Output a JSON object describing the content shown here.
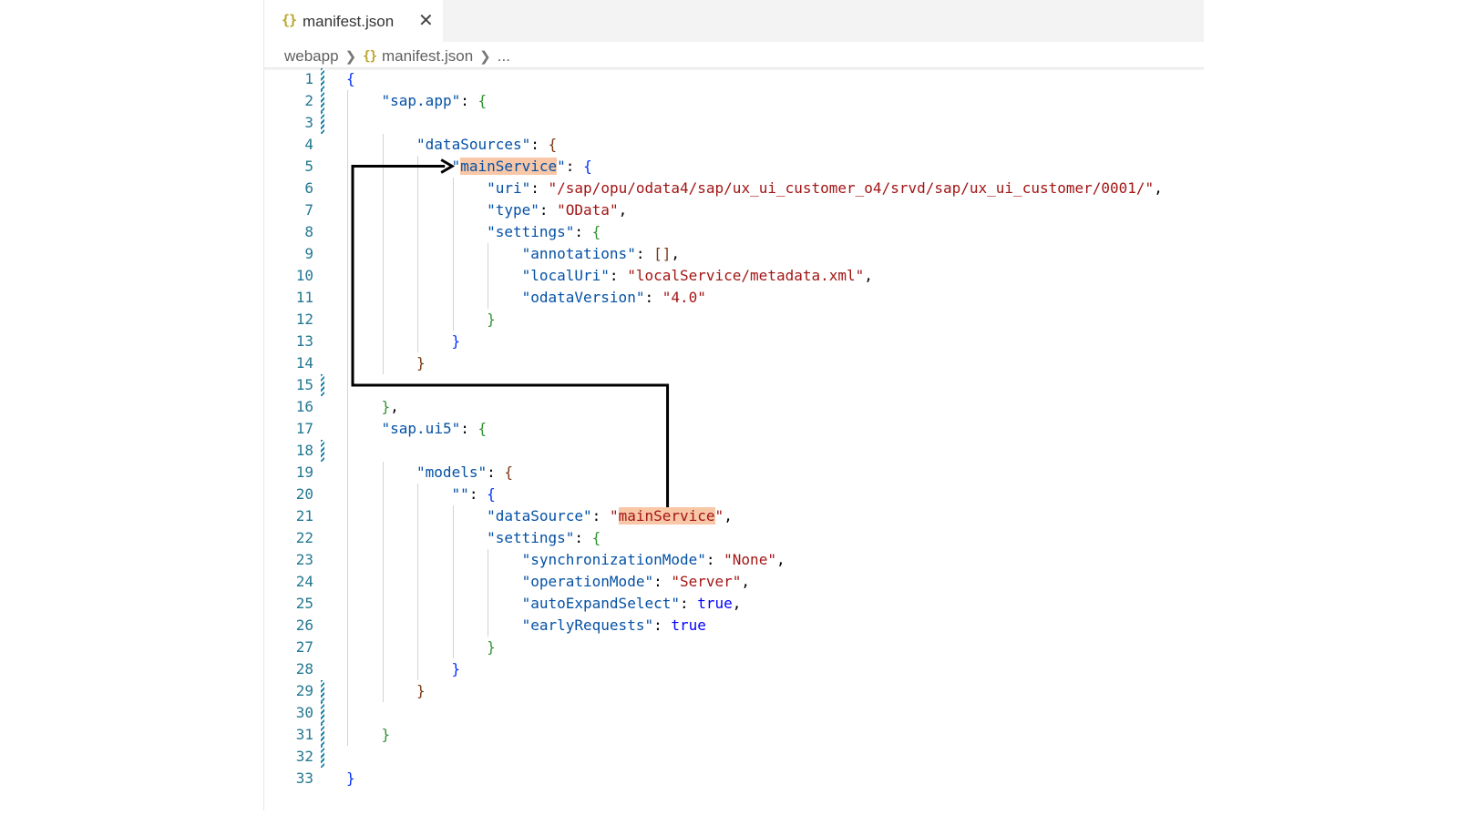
{
  "tab": {
    "icon": "{}",
    "label": "manifest.json",
    "close": "✕"
  },
  "breadcrumb": {
    "folder": "webapp",
    "icon": "{}",
    "file": "manifest.json",
    "more": "..."
  },
  "code_lines": [
    {
      "n": "1",
      "indent": 0,
      "tokens": [
        {
          "t": "{",
          "c": "p1"
        }
      ]
    },
    {
      "n": "2",
      "indent": 1,
      "tokens": [
        {
          "t": "\"sap.app\"",
          "c": "k"
        },
        {
          "t": ": "
        },
        {
          "t": "{",
          "c": "p2"
        }
      ]
    },
    {
      "n": "3",
      "indent": 0,
      "tokens": []
    },
    {
      "n": "4",
      "indent": 2,
      "tokens": [
        {
          "t": "\"dataSources\"",
          "c": "k"
        },
        {
          "t": ": "
        },
        {
          "t": "{",
          "c": "p3"
        }
      ]
    },
    {
      "n": "5",
      "indent": 3,
      "tokens": [
        {
          "t": "\"",
          "c": "k"
        },
        {
          "t": "mainService",
          "c": "k",
          "hl": true
        },
        {
          "t": "\"",
          "c": "k"
        },
        {
          "t": ": "
        },
        {
          "t": "{",
          "c": "p1"
        }
      ]
    },
    {
      "n": "6",
      "indent": 4,
      "tokens": [
        {
          "t": "\"uri\"",
          "c": "k"
        },
        {
          "t": ": "
        },
        {
          "t": "\"/sap/opu/odata4/sap/ux_ui_customer_o4/srvd/sap/ux_ui_customer/0001/\"",
          "c": "s"
        },
        {
          "t": ","
        }
      ]
    },
    {
      "n": "7",
      "indent": 4,
      "tokens": [
        {
          "t": "\"type\"",
          "c": "k"
        },
        {
          "t": ": "
        },
        {
          "t": "\"OData\"",
          "c": "s"
        },
        {
          "t": ","
        }
      ]
    },
    {
      "n": "8",
      "indent": 4,
      "tokens": [
        {
          "t": "\"settings\"",
          "c": "k"
        },
        {
          "t": ": "
        },
        {
          "t": "{",
          "c": "p2"
        }
      ]
    },
    {
      "n": "9",
      "indent": 5,
      "tokens": [
        {
          "t": "\"annotations\"",
          "c": "k"
        },
        {
          "t": ": "
        },
        {
          "t": "[]",
          "c": "p3"
        },
        {
          "t": ","
        }
      ]
    },
    {
      "n": "10",
      "indent": 5,
      "tokens": [
        {
          "t": "\"localUri\"",
          "c": "k"
        },
        {
          "t": ": "
        },
        {
          "t": "\"localService/metadata.xml\"",
          "c": "s"
        },
        {
          "t": ","
        }
      ]
    },
    {
      "n": "11",
      "indent": 5,
      "tokens": [
        {
          "t": "\"odataVersion\"",
          "c": "k"
        },
        {
          "t": ": "
        },
        {
          "t": "\"4.0\"",
          "c": "s"
        }
      ]
    },
    {
      "n": "12",
      "indent": 4,
      "tokens": [
        {
          "t": "}",
          "c": "p2"
        }
      ]
    },
    {
      "n": "13",
      "indent": 3,
      "tokens": [
        {
          "t": "}",
          "c": "p1"
        }
      ]
    },
    {
      "n": "14",
      "indent": 2,
      "tokens": [
        {
          "t": "}",
          "c": "p3"
        }
      ]
    },
    {
      "n": "15",
      "indent": 0,
      "tokens": []
    },
    {
      "n": "16",
      "indent": 1,
      "tokens": [
        {
          "t": "}",
          "c": "p2"
        },
        {
          "t": ","
        }
      ]
    },
    {
      "n": "17",
      "indent": 1,
      "tokens": [
        {
          "t": "\"sap.ui5\"",
          "c": "k"
        },
        {
          "t": ": "
        },
        {
          "t": "{",
          "c": "p2"
        }
      ]
    },
    {
      "n": "18",
      "indent": 0,
      "tokens": []
    },
    {
      "n": "19",
      "indent": 2,
      "tokens": [
        {
          "t": "\"models\"",
          "c": "k"
        },
        {
          "t": ": "
        },
        {
          "t": "{",
          "c": "p3"
        }
      ]
    },
    {
      "n": "20",
      "indent": 3,
      "tokens": [
        {
          "t": "\"\"",
          "c": "k"
        },
        {
          "t": ": "
        },
        {
          "t": "{",
          "c": "p1"
        }
      ]
    },
    {
      "n": "21",
      "indent": 4,
      "tokens": [
        {
          "t": "\"dataSource\"",
          "c": "k"
        },
        {
          "t": ": "
        },
        {
          "t": "\"",
          "c": "s"
        },
        {
          "t": "mainService",
          "c": "s",
          "hl": true
        },
        {
          "t": "\"",
          "c": "s"
        },
        {
          "t": ","
        }
      ]
    },
    {
      "n": "22",
      "indent": 4,
      "tokens": [
        {
          "t": "\"settings\"",
          "c": "k"
        },
        {
          "t": ": "
        },
        {
          "t": "{",
          "c": "p2"
        }
      ]
    },
    {
      "n": "23",
      "indent": 5,
      "tokens": [
        {
          "t": "\"synchronizationMode\"",
          "c": "k"
        },
        {
          "t": ": "
        },
        {
          "t": "\"None\"",
          "c": "s"
        },
        {
          "t": ","
        }
      ]
    },
    {
      "n": "24",
      "indent": 5,
      "tokens": [
        {
          "t": "\"operationMode\"",
          "c": "k"
        },
        {
          "t": ": "
        },
        {
          "t": "\"Server\"",
          "c": "s"
        },
        {
          "t": ","
        }
      ]
    },
    {
      "n": "25",
      "indent": 5,
      "tokens": [
        {
          "t": "\"autoExpandSelect\"",
          "c": "k"
        },
        {
          "t": ": "
        },
        {
          "t": "true",
          "c": "b"
        },
        {
          "t": ","
        }
      ]
    },
    {
      "n": "26",
      "indent": 5,
      "tokens": [
        {
          "t": "\"earlyRequests\"",
          "c": "k"
        },
        {
          "t": ": "
        },
        {
          "t": "true",
          "c": "b"
        }
      ]
    },
    {
      "n": "27",
      "indent": 4,
      "tokens": [
        {
          "t": "}",
          "c": "p2"
        }
      ]
    },
    {
      "n": "28",
      "indent": 3,
      "tokens": [
        {
          "t": "}",
          "c": "p1"
        }
      ]
    },
    {
      "n": "29",
      "indent": 2,
      "tokens": [
        {
          "t": "}",
          "c": "p3"
        }
      ]
    },
    {
      "n": "30",
      "indent": 0,
      "tokens": []
    },
    {
      "n": "31",
      "indent": 1,
      "tokens": [
        {
          "t": "}",
          "c": "p2"
        }
      ]
    },
    {
      "n": "32",
      "indent": 0,
      "tokens": []
    },
    {
      "n": "33",
      "indent": 0,
      "tokens": [
        {
          "t": "}",
          "c": "p1"
        }
      ]
    }
  ],
  "modified_lines": [
    "1",
    "2",
    "3",
    "15",
    "18",
    "29",
    "30",
    "31",
    "32"
  ],
  "colors": {
    "key": "#0451a5",
    "string": "#a31515",
    "boolean": "#0000ff",
    "line_number": "#237893",
    "highlight": "#f8c7a7",
    "arrow": "#000000"
  },
  "annotation": {
    "type": "arrow",
    "from_line": "21",
    "to_line": "5",
    "target": "mainService"
  }
}
